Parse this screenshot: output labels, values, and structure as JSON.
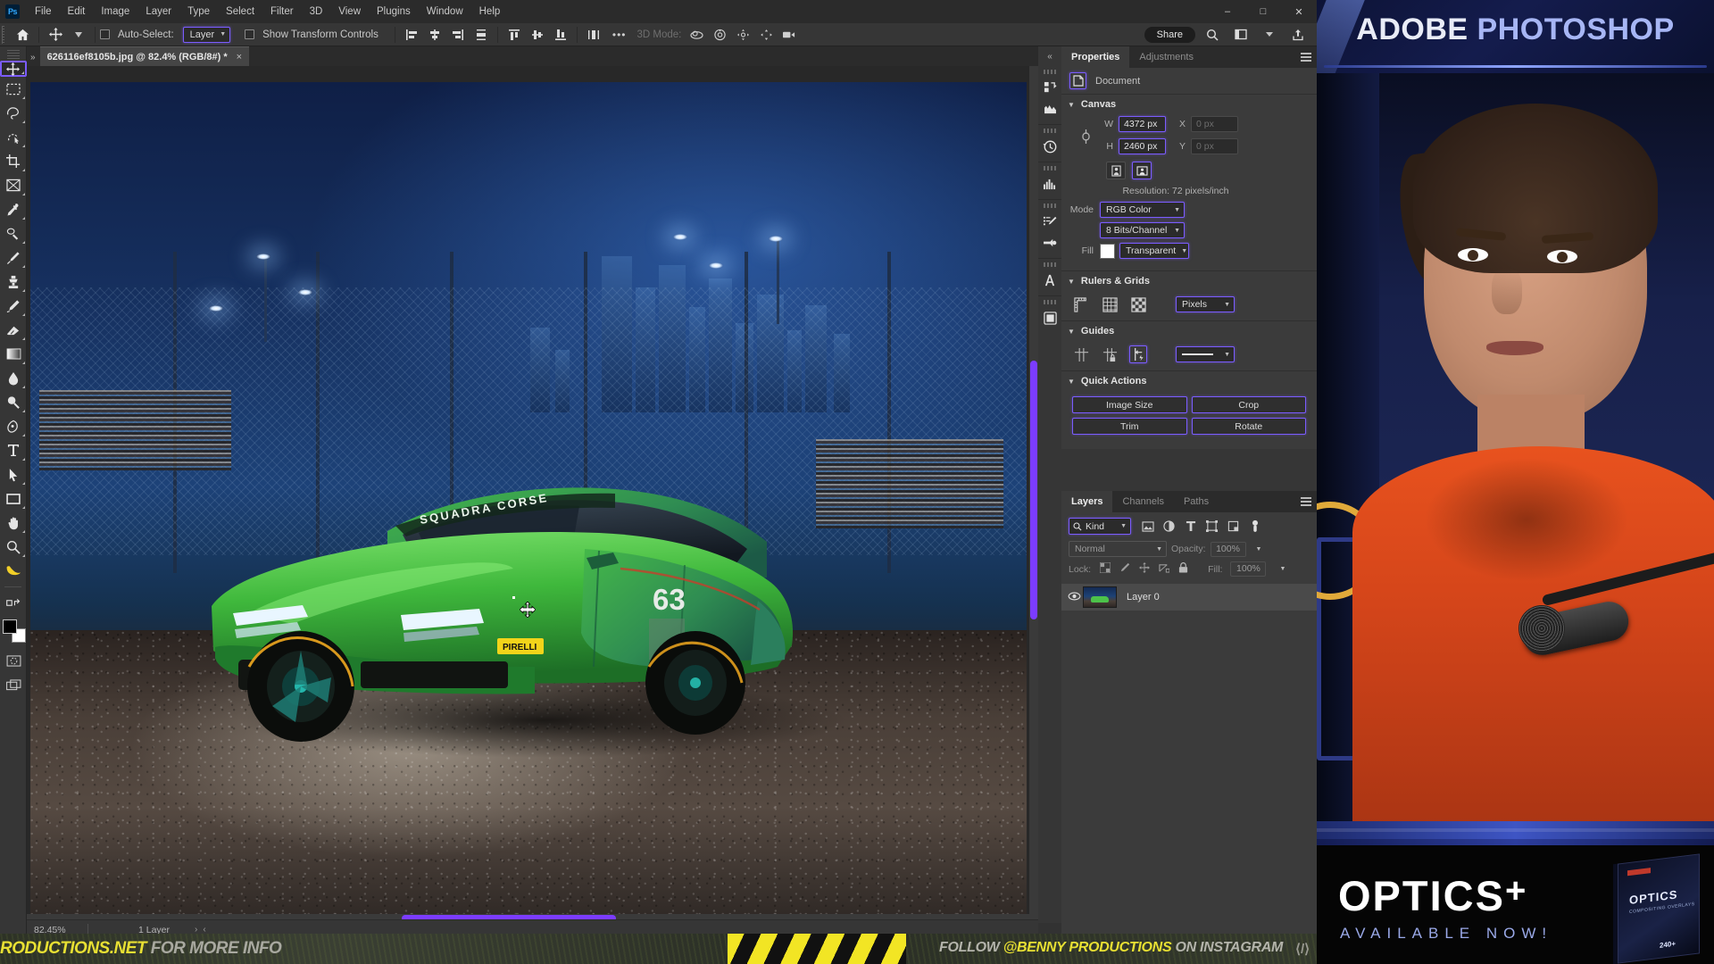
{
  "app": {
    "name": "Adobe Photoshop",
    "logo_text": "Ps",
    "menus": [
      "File",
      "Edit",
      "Image",
      "Layer",
      "Type",
      "Select",
      "Filter",
      "3D",
      "View",
      "Plugins",
      "Window",
      "Help"
    ],
    "window_controls": [
      "minimize",
      "maximize",
      "close"
    ],
    "share_label": "Share"
  },
  "options_bar": {
    "home_icon": "home-icon",
    "tool_icon": "move-tool-icon",
    "auto_select_label": "Auto-Select:",
    "auto_select_checked": false,
    "auto_select_target": "Layer",
    "show_transform_label": "Show Transform Controls",
    "show_transform_checked": false,
    "align_icons": [
      "align-left-edges",
      "align-horizontal-centers",
      "align-right-edges",
      "distribute-horizontally",
      "align-top-edges",
      "align-vertical-centers",
      "align-bottom-edges",
      "distribute-vertically"
    ],
    "more_label": "•••",
    "three_d_mode_label": "3D Mode:",
    "three_d_icons": [
      "orbit-3d",
      "roll-3d",
      "pan-3d",
      "slide-3d",
      "camera-3d"
    ]
  },
  "toolbar": {
    "tools": [
      {
        "name": "move-tool",
        "selected": true
      },
      {
        "name": "rectangular-marquee-tool",
        "selected": false
      },
      {
        "name": "lasso-tool",
        "selected": false
      },
      {
        "name": "object-selection-tool",
        "selected": false
      },
      {
        "name": "crop-tool",
        "selected": false
      },
      {
        "name": "frame-tool",
        "selected": false
      },
      {
        "name": "eyedropper-tool",
        "selected": false
      },
      {
        "name": "spot-healing-brush-tool",
        "selected": false
      },
      {
        "name": "brush-tool",
        "selected": false
      },
      {
        "name": "clone-stamp-tool",
        "selected": false
      },
      {
        "name": "history-brush-tool",
        "selected": false
      },
      {
        "name": "eraser-tool",
        "selected": false
      },
      {
        "name": "gradient-tool",
        "selected": false
      },
      {
        "name": "blur-tool",
        "selected": false
      },
      {
        "name": "dodge-tool",
        "selected": false
      },
      {
        "name": "pen-tool",
        "selected": false
      },
      {
        "name": "type-tool",
        "selected": false
      },
      {
        "name": "path-selection-tool",
        "selected": false
      },
      {
        "name": "rectangle-tool",
        "selected": false
      },
      {
        "name": "hand-tool",
        "selected": false
      },
      {
        "name": "zoom-tool",
        "selected": false
      },
      {
        "name": "banana-tool",
        "selected": false
      },
      {
        "name": "edit-toolbar",
        "selected": false
      }
    ],
    "foreground_color": "#000000",
    "background_color": "#ffffff",
    "quick_mask_icon": "quick-mask-icon",
    "screen_mode_icon": "screen-mode-icon"
  },
  "document": {
    "tab_title": "626116ef8105b.jpg @ 82.4% (RGB/8#) *",
    "close_label": "×"
  },
  "status_bar": {
    "zoom": "82.45%",
    "info": "1 Layer",
    "nav_next": "›",
    "nav_prev": "‹"
  },
  "rail_icons": [
    "libraries-icon",
    "adjustments-icon",
    "history-icon",
    "histogram-icon",
    "brush-settings-icon",
    "gradients-icon",
    "character-icon",
    "layer-comps-icon"
  ],
  "panels": {
    "top_tabs": [
      {
        "label": "Properties",
        "active": true
      },
      {
        "label": "Adjustments",
        "active": false
      }
    ],
    "properties": {
      "document_label": "Document",
      "document_icon": "document-icon",
      "canvas": {
        "title": "Canvas",
        "w_label": "W",
        "w_value": "4372 px",
        "h_label": "H",
        "h_value": "2460 px",
        "x_label": "X",
        "x_value": "0 px",
        "y_label": "Y",
        "y_value": "0 px",
        "link_icon": "link-icon",
        "portrait_icon": "portrait-orientation-icon",
        "landscape_icon": "landscape-orientation-icon",
        "orientation_selected": "landscape",
        "resolution": "Resolution: 72 pixels/inch",
        "mode_label": "Mode",
        "mode_value": "RGB Color",
        "depth_value": "8 Bits/Channel",
        "fill_label": "Fill",
        "fill_value": "Transparent",
        "fill_swatch": "#ffffff"
      },
      "rulers_grids": {
        "title": "Rulers & Grids",
        "ruler_icon": "ruler-icon",
        "grid_icon": "grid-icon",
        "transparency_grid_icon": "transparency-grid-icon",
        "units_value": "Pixels"
      },
      "guides": {
        "title": "Guides",
        "show_guides_icon": "show-guides-icon",
        "lock_guides_icon": "lock-guides-icon",
        "smart_guides_icon": "smart-guides-icon",
        "smart_guides_active": true,
        "style_value": "—————"
      },
      "quick_actions": {
        "title": "Quick Actions",
        "buttons": [
          "Image Size",
          "Crop",
          "Trim",
          "Rotate"
        ]
      }
    },
    "layers": {
      "tabs": [
        {
          "label": "Layers",
          "active": true
        },
        {
          "label": "Channels",
          "active": false
        },
        {
          "label": "Paths",
          "active": false
        }
      ],
      "filter_label": "Kind",
      "filter_icons": [
        "filter-pixel-icon",
        "filter-adjustment-icon",
        "filter-type-icon",
        "filter-shape-icon",
        "filter-smart-object-icon",
        "filter-toggle-icon"
      ],
      "blend_mode": "Normal",
      "opacity_label": "Opacity:",
      "opacity_value": "100%",
      "lock_label": "Lock:",
      "lock_icons": [
        "lock-transparent-pixels-icon",
        "lock-image-pixels-icon",
        "lock-position-icon",
        "lock-artboard-icon",
        "lock-all-icon"
      ],
      "fill_label": "Fill:",
      "fill_value": "100%",
      "rows": [
        {
          "name": "Layer 0",
          "visible": true,
          "selected": true
        }
      ],
      "bottom_icons": [
        "link-layers-icon",
        "layer-style-icon",
        "layer-mask-icon",
        "adjustment-layer-icon",
        "new-group-icon",
        "new-layer-icon",
        "delete-layer-icon"
      ]
    }
  },
  "canvas_art": {
    "description": "Night race-track composite: green Lamborghini Urus ST-X on gravel with city skyline and fencing",
    "car_livery_text": "SQUADRA CORSE",
    "car_number": "63",
    "sponsor_text": "PIRELLI",
    "accent_green": "#3ec43c",
    "cursor_icon": "move-cursor-icon"
  },
  "webcam": {
    "header_word1": "ADOBE",
    "header_word2": "PHOTOSHOP",
    "footer_brand": "OPTICS",
    "footer_plus": "+",
    "footer_tagline": "AVAILABLE NOW!",
    "box_title": "OPTICS",
    "box_subtitle": "COMPOSITING OVERLAYS",
    "box_count": "240+"
  },
  "banner": {
    "left_yellow": "RODUCTIONS.NET",
    "left_gray": "FOR MORE INFO",
    "right_gray1": "FOLLOW ",
    "right_yellow": "@BENNY PRODUCTIONS",
    "right_gray2": " ON INSTAGRAM",
    "instagram_icon": "instagram-icon"
  }
}
